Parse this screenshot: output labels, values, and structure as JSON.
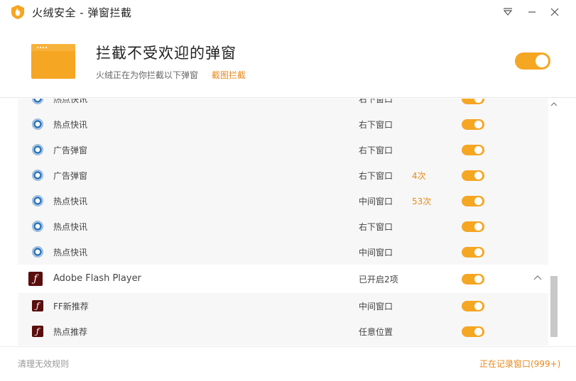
{
  "window": {
    "title": "火绒安全 - 弹窗拦截",
    "menu_icon": "menu-dropdown-icon",
    "minimize_icon": "minimize-icon",
    "close_icon": "close-icon"
  },
  "header": {
    "title": "拦截不受欢迎的弹窗",
    "subtitle": "火绒正在为你拦截以下弹窗",
    "link": "截图拦截",
    "enabled": true
  },
  "rows": [
    {
      "icon": "gear-app-icon",
      "name": "热点快讯",
      "position": "右下窗口",
      "count": "",
      "enabled": true
    },
    {
      "icon": "gear-app-icon",
      "name": "热点快讯",
      "position": "右下窗口",
      "count": "",
      "enabled": true
    },
    {
      "icon": "gear-app-icon",
      "name": "广告弹窗",
      "position": "右下窗口",
      "count": "",
      "enabled": true
    },
    {
      "icon": "gear-app-icon",
      "name": "广告弹窗",
      "position": "右下窗口",
      "count": "4次",
      "enabled": true
    },
    {
      "icon": "gear-app-icon",
      "name": "热点快讯",
      "position": "中间窗口",
      "count": "53次",
      "enabled": true
    },
    {
      "icon": "gear-app-icon",
      "name": "热点快讯",
      "position": "右下窗口",
      "count": "",
      "enabled": true
    },
    {
      "icon": "gear-app-icon",
      "name": "热点快讯",
      "position": "中间窗口",
      "count": "",
      "enabled": true
    }
  ],
  "group": {
    "icon": "flash-icon",
    "name": "Adobe Flash Player",
    "status": "已开启2项",
    "enabled": true,
    "expanded": true
  },
  "group_rows": [
    {
      "icon": "flash-icon",
      "name": "FF新推荐",
      "position": "中间窗口",
      "enabled": true
    },
    {
      "icon": "flash-icon",
      "name": "热点推荐",
      "position": "任意位置",
      "enabled": true
    }
  ],
  "footer": {
    "left": "清理无效规则",
    "right": "正在记录窗口(999+)"
  },
  "colors": {
    "accent": "#f5a623",
    "link": "#e8891c"
  }
}
